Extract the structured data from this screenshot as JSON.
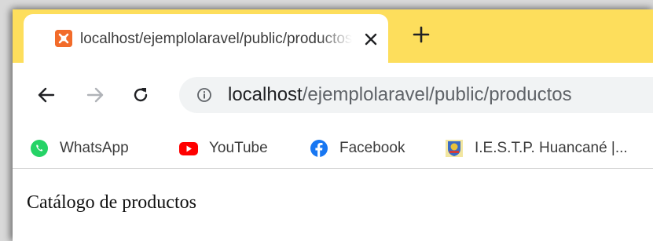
{
  "tab": {
    "title": "localhost/ejemplolaravel/public/productos",
    "favicon": "xampp-icon"
  },
  "address_bar": {
    "host": "localhost",
    "path": "/ejemplolaravel/public/productos"
  },
  "bookmarks": [
    {
      "label": "WhatsApp",
      "icon": "whatsapp-icon"
    },
    {
      "label": "YouTube",
      "icon": "youtube-icon"
    },
    {
      "label": "Facebook",
      "icon": "facebook-icon"
    },
    {
      "label": "I.E.S.T.P. Huancané |...",
      "icon": "institute-crest-icon"
    }
  ],
  "page": {
    "text": "Catálogo de productos"
  },
  "colors": {
    "tabstrip": "#fdde5c",
    "omnibox": "#f1f3f4",
    "whatsapp": "#25d366",
    "youtube": "#ff0000",
    "facebook": "#1877f2",
    "xampp": "#f26b2a"
  }
}
